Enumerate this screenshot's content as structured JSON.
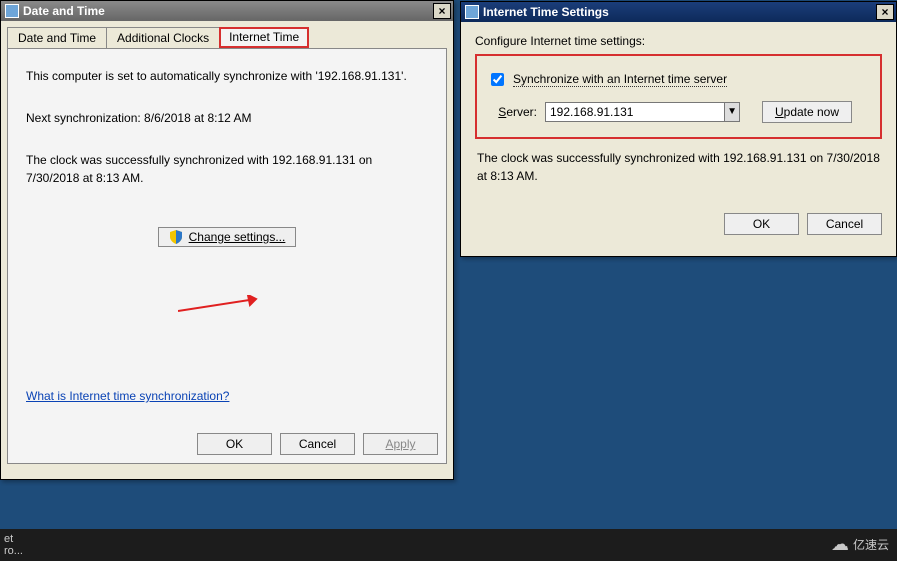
{
  "dt": {
    "title": "Date and Time",
    "tabs": {
      "datetime": "Date and Time",
      "addclocks": "Additional Clocks",
      "internet": "Internet Time"
    },
    "info_sync": "This computer is set to automatically synchronize with '192.168.91.131'.",
    "info_next": "Next synchronization: 8/6/2018 at 8:12 AM",
    "info_status": "The clock was successfully synchronized with 192.168.91.131 on 7/30/2018 at 8:13 AM.",
    "change_settings": "Change settings...",
    "help_link": "What is Internet time synchronization?",
    "ok": "OK",
    "cancel": "Cancel",
    "apply": "Apply"
  },
  "its": {
    "title": "Internet Time Settings",
    "configure": "Configure Internet time settings:",
    "sync_label": "Synchronize with an Internet time server",
    "server_label": "Server:",
    "server_value": "192.168.91.131",
    "update_now": "Update now",
    "status": "The clock was successfully synchronized with 192.168.91.131 on 7/30/2018 at 8:13 AM.",
    "ok": "OK",
    "cancel": "Cancel"
  },
  "taskbar": {
    "item": "et\nro..."
  },
  "watermark": "亿速云"
}
